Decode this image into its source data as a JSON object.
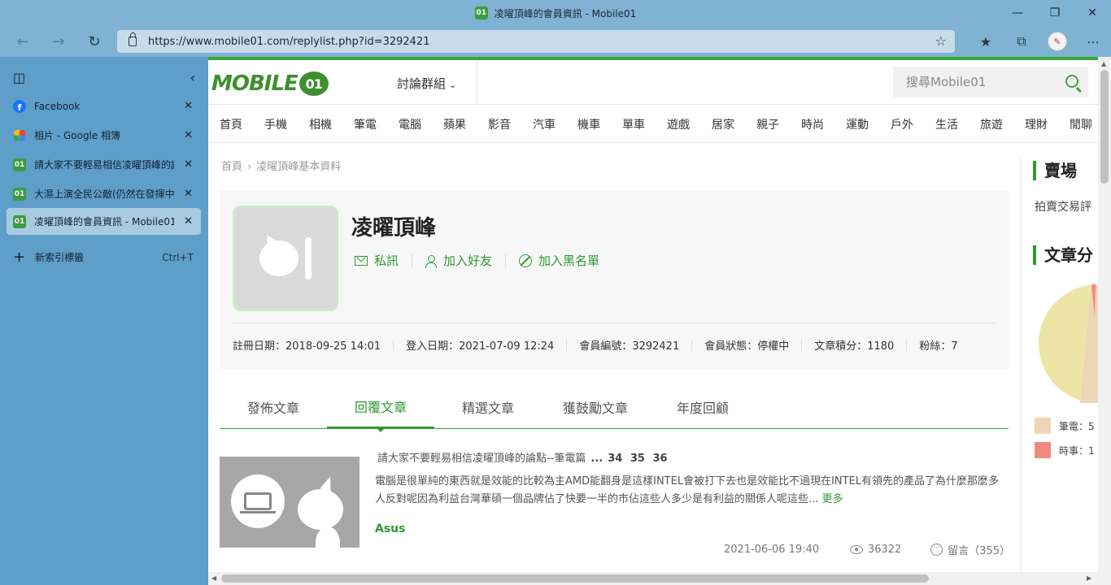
{
  "window": {
    "title": "凌曜頂峰的會員資訊 - Mobile01",
    "favicon_text": "01"
  },
  "toolbar": {
    "url": "https://www.mobile01.com/replylist.php?id=3292421"
  },
  "sidebar": {
    "tabs": [
      {
        "label": "Facebook",
        "icon": "facebook-icon"
      },
      {
        "label": "相片 - Google 相簿",
        "icon": "google-photos-icon"
      },
      {
        "label": "請大家不要輕易相信凌曜頂峰的論點",
        "icon": "mobile01-icon"
      },
      {
        "label": "大濕上演全民公敵(仍然在發揮中",
        "icon": "mobile01-icon"
      },
      {
        "label": "凌曜頂峰的會員資訊 - Mobile01",
        "icon": "mobile01-icon",
        "active": true
      }
    ],
    "new_tab_label": "新索引標籤",
    "new_tab_shortcut": "Ctrl+T"
  },
  "header": {
    "logo_text": "MOBILE",
    "logo_mark": "01",
    "forum_menu": "討論群組",
    "search_placeholder": "搜尋Mobile01"
  },
  "categories": [
    "首頁",
    "手機",
    "相機",
    "筆電",
    "電腦",
    "蘋果",
    "影音",
    "汽車",
    "機車",
    "單車",
    "遊戲",
    "居家",
    "親子",
    "時尚",
    "運動",
    "戶外",
    "生活",
    "旅遊",
    "理財",
    "閒聊"
  ],
  "breadcrumb": {
    "home": "首頁",
    "current": "凌曜頂峰基本資料"
  },
  "profile": {
    "name": "凌曜頂峰",
    "actions": {
      "message": "私訊",
      "add_friend": "加入好友",
      "block": "加入黑名單"
    },
    "stats": [
      "註冊日期：2018-09-25 14:01",
      "登入日期：2021-07-09 12:24",
      "會員編號：3292421",
      "會員狀態：停權中",
      "文章積分：1180",
      "粉絲：7"
    ]
  },
  "tabs": [
    {
      "label": "發佈文章",
      "active": false
    },
    {
      "label": "回覆文章",
      "active": true
    },
    {
      "label": "精選文章",
      "active": false
    },
    {
      "label": "獲鼓勵文章",
      "active": false
    },
    {
      "label": "年度回顧",
      "active": false
    }
  ],
  "post": {
    "title": "請大家不要輕易相信凌曜頂峰的論點--筆電篇",
    "ellipsis": "...",
    "pages": "34 35 36",
    "excerpt": "電腦是很單純的東西就是效能的比較為主AMD能翻身是這樣INTEL會被打下去也是效能比不過現在INTEL有領先的產品了為什麼那麼多人反對呢因為利益台灣華碩一個品牌佔了快要一半的市佔這些人多少是有利益的關係人呢這些...",
    "more": "更多",
    "forum": "Asus",
    "date": "2021-06-06 19:40",
    "views": "36322",
    "comments": "留言（355）"
  },
  "rail": {
    "market_title": "賣場",
    "market_text": "拍賣交易評",
    "articles_title": "文章分",
    "legend": [
      {
        "label": "筆電：5",
        "color": "#ecd6b8"
      },
      {
        "label": "時事：1",
        "color": "#ef8a80"
      }
    ],
    "pie_colors": [
      "#ece5a6",
      "#ecd6b8",
      "#ef8a80"
    ]
  }
}
